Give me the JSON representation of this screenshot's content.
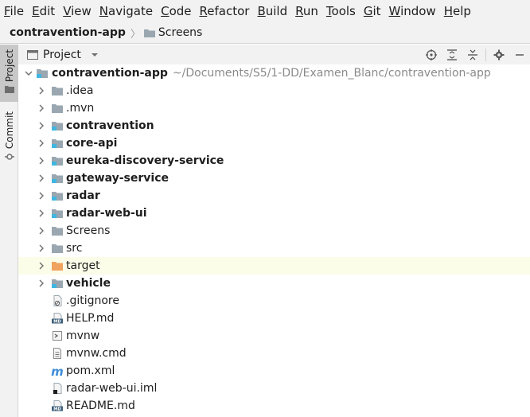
{
  "menubar": {
    "items": [
      {
        "mnemonic": "F",
        "rest": "ile"
      },
      {
        "mnemonic": "E",
        "rest": "dit"
      },
      {
        "mnemonic": "V",
        "rest": "iew"
      },
      {
        "mnemonic": "N",
        "rest": "avigate"
      },
      {
        "mnemonic": "C",
        "rest": "ode"
      },
      {
        "mnemonic": "R",
        "rest": "efactor"
      },
      {
        "mnemonic": "B",
        "rest": "uild"
      },
      {
        "mnemonic": "R",
        "rest": "un"
      },
      {
        "mnemonic": "T",
        "rest": "ools"
      },
      {
        "mnemonic": "G",
        "rest": "it"
      },
      {
        "mnemonic": "W",
        "rest": "indow"
      },
      {
        "mnemonic": "H",
        "rest": "elp"
      }
    ]
  },
  "breadcrumb": {
    "root": "contravention-app",
    "separator": "〉",
    "current": "Screens"
  },
  "stripe": {
    "project_label": "Project",
    "commit_label": "Commit"
  },
  "tool_window": {
    "title": "Project",
    "dropdown_icon": "chevron-down-icon",
    "actions": [
      "crosshair-icon",
      "expand-all-icon",
      "collapse-all-icon",
      "gear-icon",
      "minimize-icon"
    ]
  },
  "tree": {
    "root": {
      "name": "contravention-app",
      "path": "~/Documents/S5/1-DD/Examen_Blanc/contravention-app",
      "expanded": true
    },
    "items": [
      {
        "name": ".idea",
        "kind": "folder",
        "bold": false,
        "expandable": true
      },
      {
        "name": ".mvn",
        "kind": "folder",
        "bold": false,
        "expandable": true
      },
      {
        "name": "contravention",
        "kind": "module",
        "bold": true,
        "expandable": true
      },
      {
        "name": "core-api",
        "kind": "module",
        "bold": true,
        "expandable": true
      },
      {
        "name": "eureka-discovery-service",
        "kind": "module",
        "bold": true,
        "expandable": true
      },
      {
        "name": "gateway-service",
        "kind": "module",
        "bold": true,
        "expandable": true
      },
      {
        "name": "radar",
        "kind": "module",
        "bold": true,
        "expandable": true
      },
      {
        "name": "radar-web-ui",
        "kind": "module",
        "bold": true,
        "expandable": true
      },
      {
        "name": "Screens",
        "kind": "folder",
        "bold": false,
        "expandable": true
      },
      {
        "name": "src",
        "kind": "folder",
        "bold": false,
        "expandable": true
      },
      {
        "name": "target",
        "kind": "excluded-folder",
        "bold": false,
        "expandable": true,
        "selected": true
      },
      {
        "name": "vehicle",
        "kind": "module",
        "bold": true,
        "expandable": true
      },
      {
        "name": ".gitignore",
        "kind": "gitignore-file",
        "bold": false,
        "expandable": false
      },
      {
        "name": "HELP.md",
        "kind": "md-file",
        "bold": false,
        "expandable": false
      },
      {
        "name": "mvnw",
        "kind": "shell-file",
        "bold": false,
        "expandable": false
      },
      {
        "name": "mvnw.cmd",
        "kind": "text-file",
        "bold": false,
        "expandable": false
      },
      {
        "name": "pom.xml",
        "kind": "maven-file",
        "bold": false,
        "expandable": false
      },
      {
        "name": "radar-web-ui.iml",
        "kind": "iml-file",
        "bold": false,
        "expandable": false
      },
      {
        "name": "README.md",
        "kind": "md-file",
        "bold": false,
        "expandable": false
      }
    ]
  },
  "colors": {
    "folder": "#9aa7b0",
    "module_marker": "#40b6e0",
    "excluded_folder": "#f0a35e",
    "maven": "#3d8cd8",
    "selection": "#fcfde8"
  }
}
